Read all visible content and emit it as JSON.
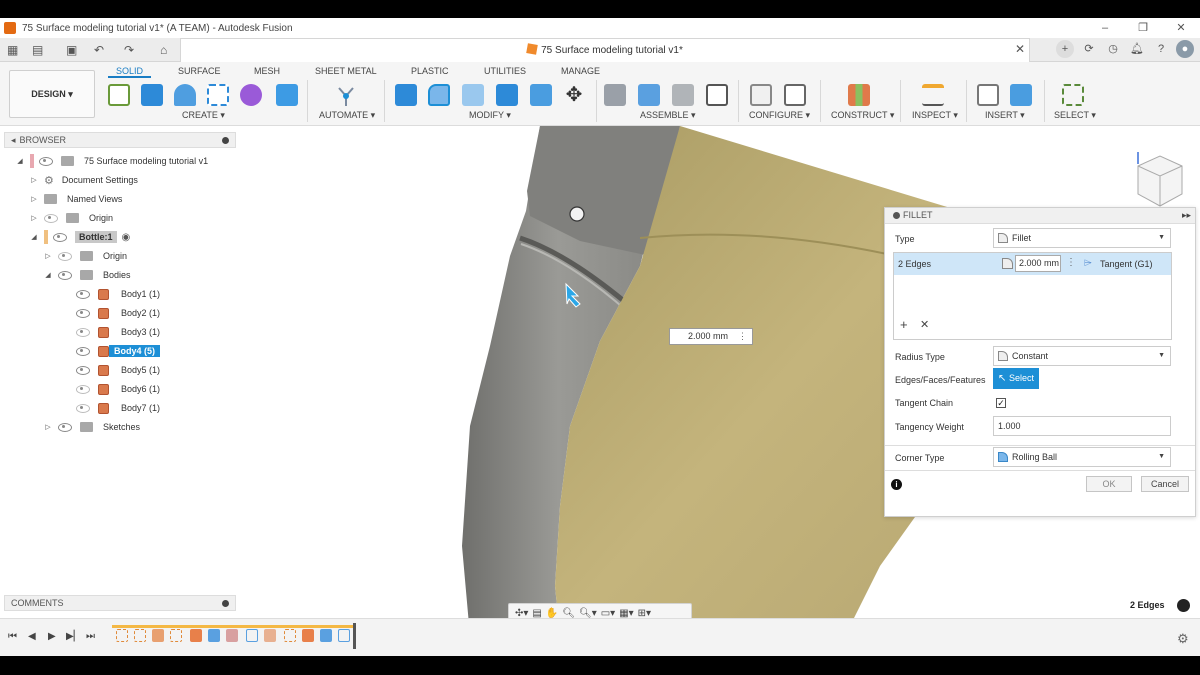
{
  "window": {
    "title": "75 Surface modeling tutorial v1* (A TEAM) - Autodesk Fusion",
    "controls": [
      "–",
      "❐",
      "✕"
    ]
  },
  "document_tab": {
    "title": "75 Surface modeling tutorial v1*",
    "close": "✕"
  },
  "toolbar": {
    "workspace": "DESIGN ▾",
    "tabs": [
      "SOLID",
      "SURFACE",
      "MESH",
      "SHEET METAL",
      "PLASTIC",
      "UTILITIES",
      "MANAGE"
    ],
    "active_tab": "SOLID",
    "groups": [
      "CREATE ▾",
      "AUTOMATE ▾",
      "MODIFY ▾",
      "ASSEMBLE ▾",
      "CONFIGURE ▾",
      "CONSTRUCT ▾",
      "INSPECT ▾",
      "INSERT ▾",
      "SELECT ▾"
    ]
  },
  "browser": {
    "header": "BROWSER",
    "items": [
      {
        "label": "75 Surface modeling tutorial v1"
      },
      {
        "label": "Document Settings"
      },
      {
        "label": "Named Views"
      },
      {
        "label": "Origin"
      },
      {
        "label": "Bottle:1"
      },
      {
        "label": "Origin"
      },
      {
        "label": "Bodies"
      },
      {
        "label": "Body1 (1)"
      },
      {
        "label": "Body2 (1)"
      },
      {
        "label": "Body3 (1)"
      },
      {
        "label": "Body4 (5)"
      },
      {
        "label": "Body5 (1)"
      },
      {
        "label": "Body6 (1)"
      },
      {
        "label": "Body7 (1)"
      },
      {
        "label": "Sketches"
      }
    ]
  },
  "comments": {
    "header": "COMMENTS"
  },
  "viewport": {
    "dimension_value": "2.000 mm",
    "status": "2 Edges"
  },
  "fillet": {
    "title": "FILLET",
    "type_label": "Type",
    "type_value": "Fillet",
    "selection_label": "2 Edges",
    "selection_value": "2.000 mm",
    "selection_continuity": "Tangent (G1)",
    "radius_type_label": "Radius Type",
    "radius_type_value": "Constant",
    "edges_label": "Edges/Faces/Features",
    "select_btn": "Select",
    "tangent_chain_label": "Tangent Chain",
    "tangent_chain_checked": "✓",
    "tangency_weight_label": "Tangency Weight",
    "tangency_weight_value": "1.000",
    "corner_type_label": "Corner Type",
    "corner_type_value": "Rolling Ball",
    "ok": "OK",
    "cancel": "Cancel"
  },
  "colors": {
    "accent": "#1d8fd6",
    "body_gray": "#8a8a86",
    "body_yellow": "#c3b27a"
  }
}
